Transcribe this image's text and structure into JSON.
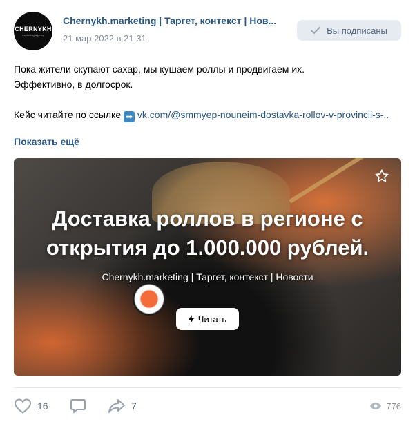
{
  "author": {
    "avatar_text": "CHERNYKH",
    "avatar_subtext": "marketing agency",
    "name": "Chernykh.marketing | Таргет, контекст | Нов...",
    "date": "21 мар 2022 в 21:31"
  },
  "subscribe_button": {
    "label": "Вы подписаны"
  },
  "post": {
    "line1": "Пока жители скупают сахар, мы кушаем роллы и продвигаем их.",
    "line2": "Эффективно, в долгосрок.",
    "link_prefix": "Кейс читайте по ссылке",
    "link_emoji": "➡",
    "link_text": "vk.com/@smmyep-nouneim-dostavka-rollov-v-provincii-s-..",
    "show_more": "Показать ещё"
  },
  "card": {
    "headline_line1": "Доставка роллов в регионе с",
    "headline_line2": "открытия до 1.000.000 рублей.",
    "subline": "Chernykh.marketing | Таргет, контекст | Новости",
    "read_button": "Читать"
  },
  "actions": {
    "likes": "16",
    "shares": "7",
    "views": "776"
  },
  "colors": {
    "link": "#2a5885",
    "secondary_text": "#818c99",
    "button_bg": "#e5ebf1"
  }
}
